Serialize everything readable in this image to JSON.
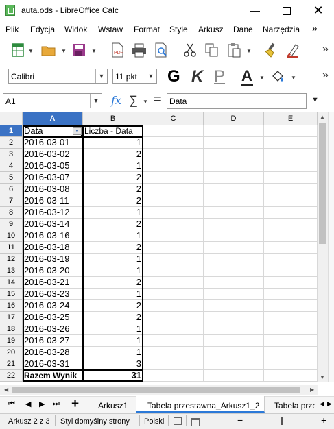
{
  "window": {
    "title": "auta.ods - LibreOffice Calc"
  },
  "menu": [
    "Plik",
    "Edycja",
    "Widok",
    "Wstaw",
    "Format",
    "Style",
    "Arkusz",
    "Dane",
    "Narzędzia",
    "»"
  ],
  "format_bar": {
    "font_name": "Calibri",
    "font_size": "11 pkt",
    "bold": "G",
    "italic": "K",
    "underline": "P",
    "more": "»"
  },
  "formula_bar": {
    "name_box": "A1",
    "function_glyph": "fx",
    "sum_glyph": "∑",
    "equals_glyph": "=",
    "content": "Data"
  },
  "columns": [
    "A",
    "B",
    "C",
    "D",
    "E"
  ],
  "rows": [
    "1",
    "2",
    "3",
    "4",
    "5",
    "6",
    "7",
    "8",
    "9",
    "10",
    "11",
    "12",
    "13",
    "14",
    "15",
    "16",
    "17",
    "18",
    "19",
    "20",
    "21",
    "22"
  ],
  "pivot": {
    "header_a": "Data",
    "header_b": "Liczba - Data",
    "dates": [
      "2016-03-01",
      "2016-03-02",
      "2016-03-05",
      "2016-03-07",
      "2016-03-08",
      "2016-03-11",
      "2016-03-12",
      "2016-03-14",
      "2016-03-16",
      "2016-03-18",
      "2016-03-19",
      "2016-03-20",
      "2016-03-21",
      "2016-03-23",
      "2016-03-24",
      "2016-03-25",
      "2016-03-26",
      "2016-03-27",
      "2016-03-28",
      "2016-03-31"
    ],
    "counts": [
      "1",
      "2",
      "1",
      "2",
      "2",
      "2",
      "1",
      "2",
      "1",
      "2",
      "1",
      "1",
      "2",
      "1",
      "2",
      "2",
      "1",
      "1",
      "1",
      "3"
    ],
    "total_label": "Razem Wynik",
    "total_value": "31"
  },
  "sheet_tabs": {
    "add": "+",
    "tabs": [
      "Arkusz1",
      "Tabela przestawna_Arkusz1_2",
      "Tabela przes"
    ],
    "active_index": 1
  },
  "status_bar": {
    "sheet_info": "Arkusz 2 z 3",
    "page_style": "Styl domyślny strony",
    "language": "Polski",
    "zoom_minus": "−",
    "zoom_plus": "+"
  },
  "colors": {
    "accent": "#2b79d8",
    "selected_header": "#3a72c4",
    "selected_header_text": "#ffffff"
  }
}
